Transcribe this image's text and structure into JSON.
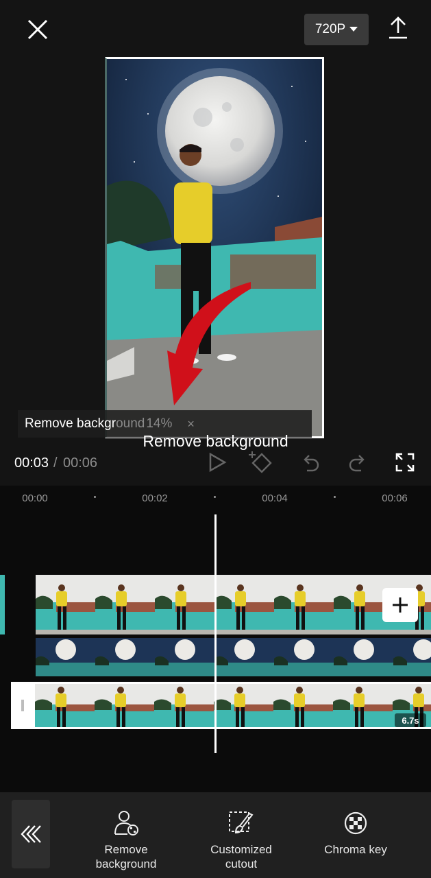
{
  "header": {
    "close_icon": "close-icon",
    "resolution_label": "720P",
    "export_icon": "upload-icon"
  },
  "overlay": {
    "progress_label": "Remove backgr",
    "progress_label_cont": "ound",
    "progress_percent": "14%",
    "progress_close": "×",
    "caption": "Remove background"
  },
  "transport": {
    "current_time": "00:03",
    "separator": "/",
    "total_time": "00:06",
    "icons": [
      "play-icon",
      "keyframe-add-icon",
      "undo-icon",
      "redo-icon",
      "fullscreen-icon"
    ]
  },
  "timeline": {
    "ticks": [
      "00:00",
      "00:02",
      "00:04",
      "00:06"
    ],
    "clip_duration": "6.7s",
    "add_icon": "plus-icon"
  },
  "toolbar": {
    "back_icon": "double-chevron-left-icon",
    "tools": [
      {
        "label_line1": "Remove",
        "label_line2": "background",
        "icon": "person-remove-bg-icon"
      },
      {
        "label_line1": "Customized",
        "label_line2": "cutout",
        "icon": "brush-cutout-icon"
      },
      {
        "label_line1": "Chroma key",
        "label_line2": "",
        "icon": "chroma-key-icon"
      }
    ]
  },
  "colors": {
    "background": "#141414",
    "timeline_bg": "#0b0b0b",
    "toolbar_bg": "#202020",
    "arrow_red": "#d0101a",
    "wall_teal": "#3fb8b0"
  }
}
